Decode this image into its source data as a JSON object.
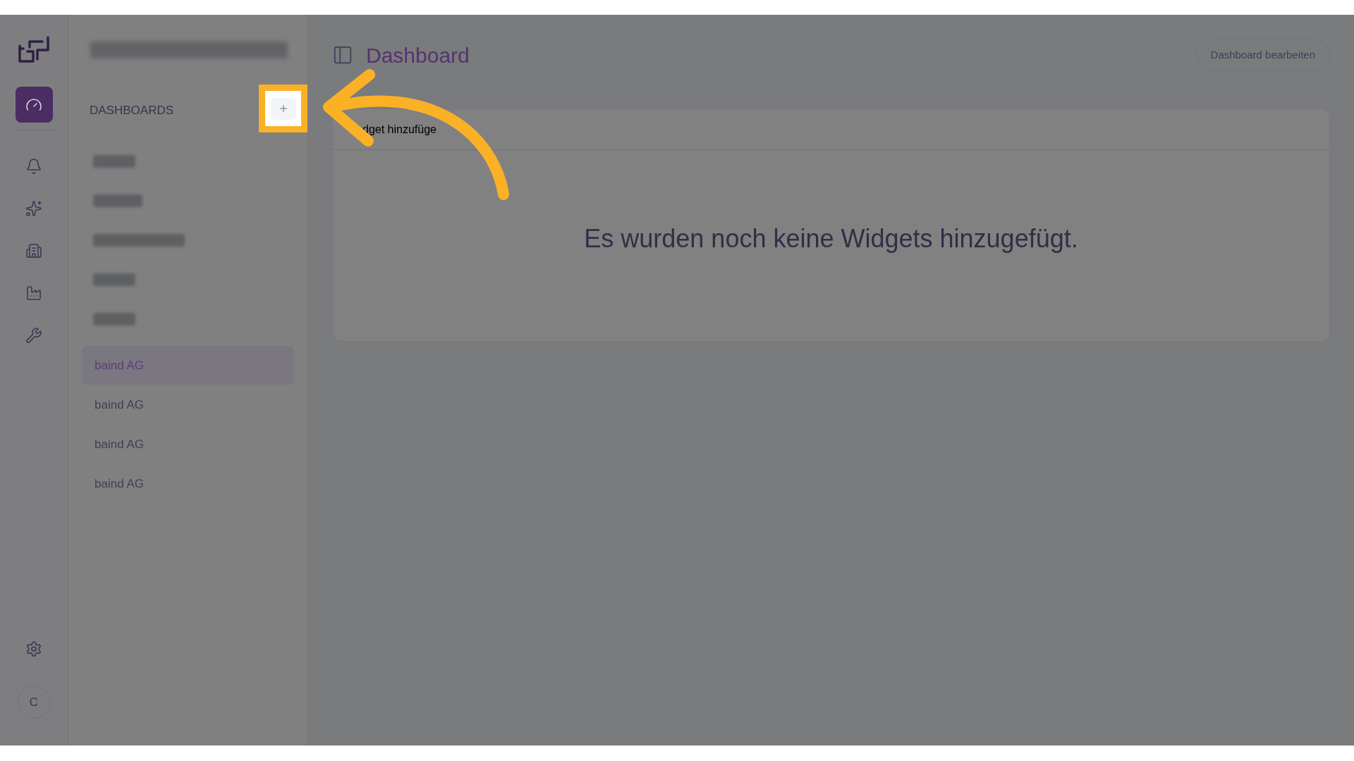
{
  "rail": {
    "nav": [
      {
        "kind": "gauge",
        "selected": true
      },
      {
        "kind": "bell",
        "selected": false
      },
      {
        "kind": "sparkles",
        "selected": false
      },
      {
        "kind": "buildings",
        "selected": false
      },
      {
        "kind": "factory",
        "selected": false
      },
      {
        "kind": "wrench",
        "selected": false
      }
    ],
    "avatar": "C"
  },
  "sidebar": {
    "heading": "DASHBOARDS",
    "items": [
      {
        "label": "baind AG",
        "selected": true
      },
      {
        "label": "baind AG",
        "selected": false
      },
      {
        "label": "baind AG",
        "selected": false
      },
      {
        "label": "baind AG",
        "selected": false
      }
    ]
  },
  "header": {
    "title": "Dashboard",
    "edit_button": "Dashboard bearbeiten"
  },
  "card": {
    "header": "dget hinzufüge",
    "empty_message": "Es wurden noch keine Widgets hinzugefügt."
  }
}
